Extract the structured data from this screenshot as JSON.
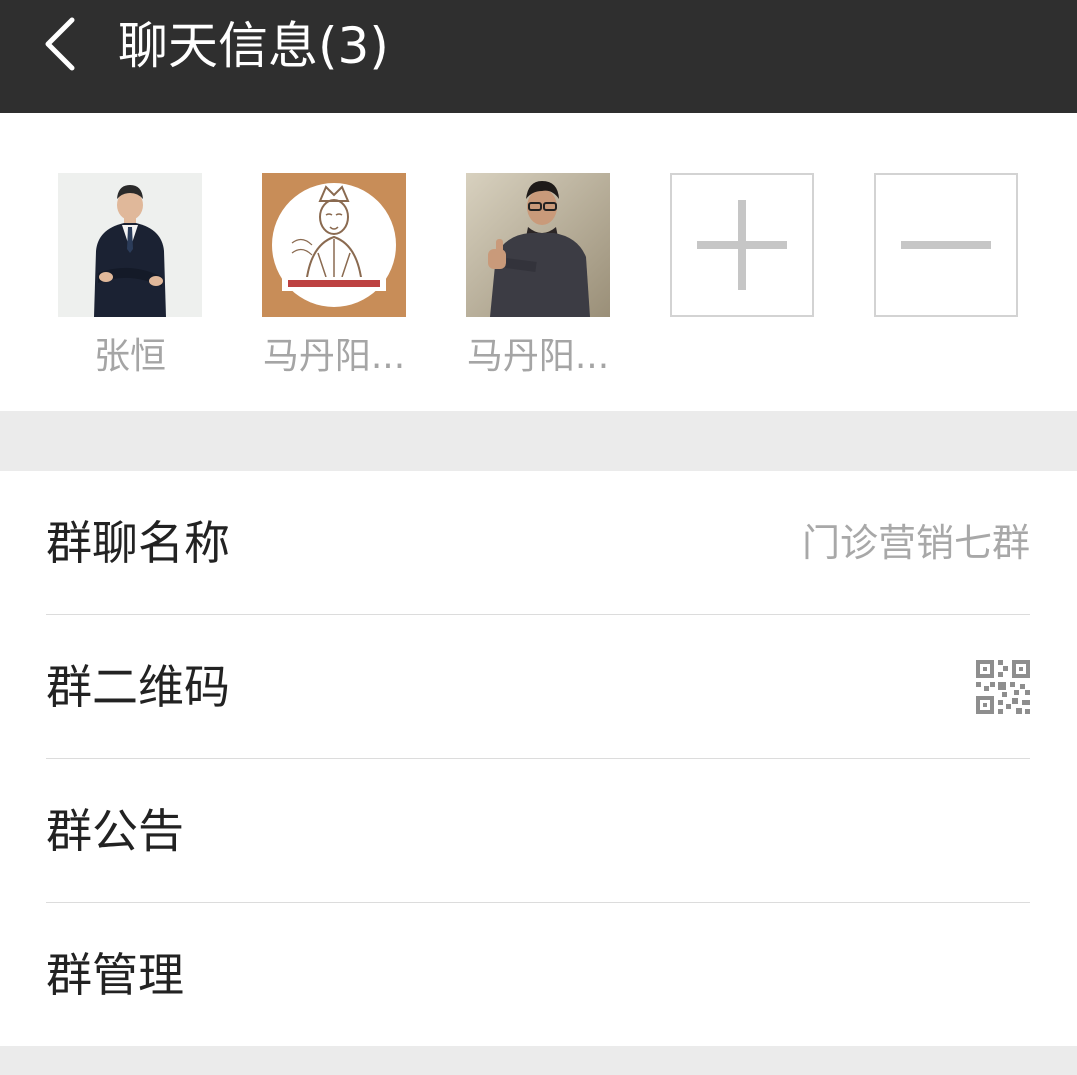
{
  "header": {
    "back_icon": "chevron-left-icon",
    "title": "聊天信息(3)"
  },
  "members": [
    {
      "name": "张恒",
      "avatar": "avatar-man-in-suit"
    },
    {
      "name": "马丹阳...",
      "avatar": "avatar-ancient-figure-drawing"
    },
    {
      "name": "马丹阳...",
      "avatar": "avatar-man-thumbs-up"
    }
  ],
  "member_actions": {
    "add_icon": "plus-icon",
    "remove_icon": "minus-icon"
  },
  "settings": {
    "group_name": {
      "label": "群聊名称",
      "value": "门诊营销七群"
    },
    "group_qr": {
      "label": "群二维码",
      "icon": "qr-code-icon"
    },
    "group_notice": {
      "label": "群公告"
    },
    "group_manage": {
      "label": "群管理"
    }
  },
  "colors": {
    "topbar": "#2f2f2f",
    "background": "#ebebeb",
    "muted_text": "#a5a5a5"
  }
}
